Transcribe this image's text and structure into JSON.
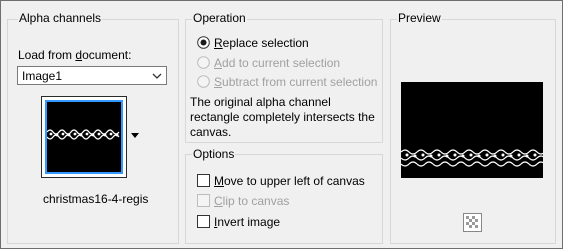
{
  "alpha": {
    "title": "Alpha channels",
    "load_label_pre": "Load from ",
    "load_label_u": "d",
    "load_label_post": "ocument:",
    "document_value": "Image1",
    "thumb_caption": "christmas16-4-regis"
  },
  "operation": {
    "title": "Operation",
    "options": [
      {
        "pre": "",
        "u": "R",
        "post": "eplace selection",
        "checked": true,
        "enabled": true
      },
      {
        "pre": "",
        "u": "A",
        "post": "dd to current selection",
        "checked": false,
        "enabled": false
      },
      {
        "pre": "",
        "u": "S",
        "post": "ubtract from current selection",
        "checked": false,
        "enabled": false
      }
    ],
    "description": "The original alpha channel rectangle completely intersects the canvas."
  },
  "options": {
    "title": "Options",
    "items": [
      {
        "pre": "",
        "u": "M",
        "post": "ove to upper left of canvas",
        "checked": false,
        "enabled": true
      },
      {
        "pre": "",
        "u": "C",
        "post": "lip to canvas",
        "checked": false,
        "enabled": false
      },
      {
        "pre": "",
        "u": "I",
        "post": "nvert image",
        "checked": false,
        "enabled": true
      }
    ]
  },
  "preview": {
    "title": "Preview"
  },
  "colors": {
    "accent": "#3399ff",
    "image_bg": "#000000",
    "lace": "#ffffff"
  }
}
